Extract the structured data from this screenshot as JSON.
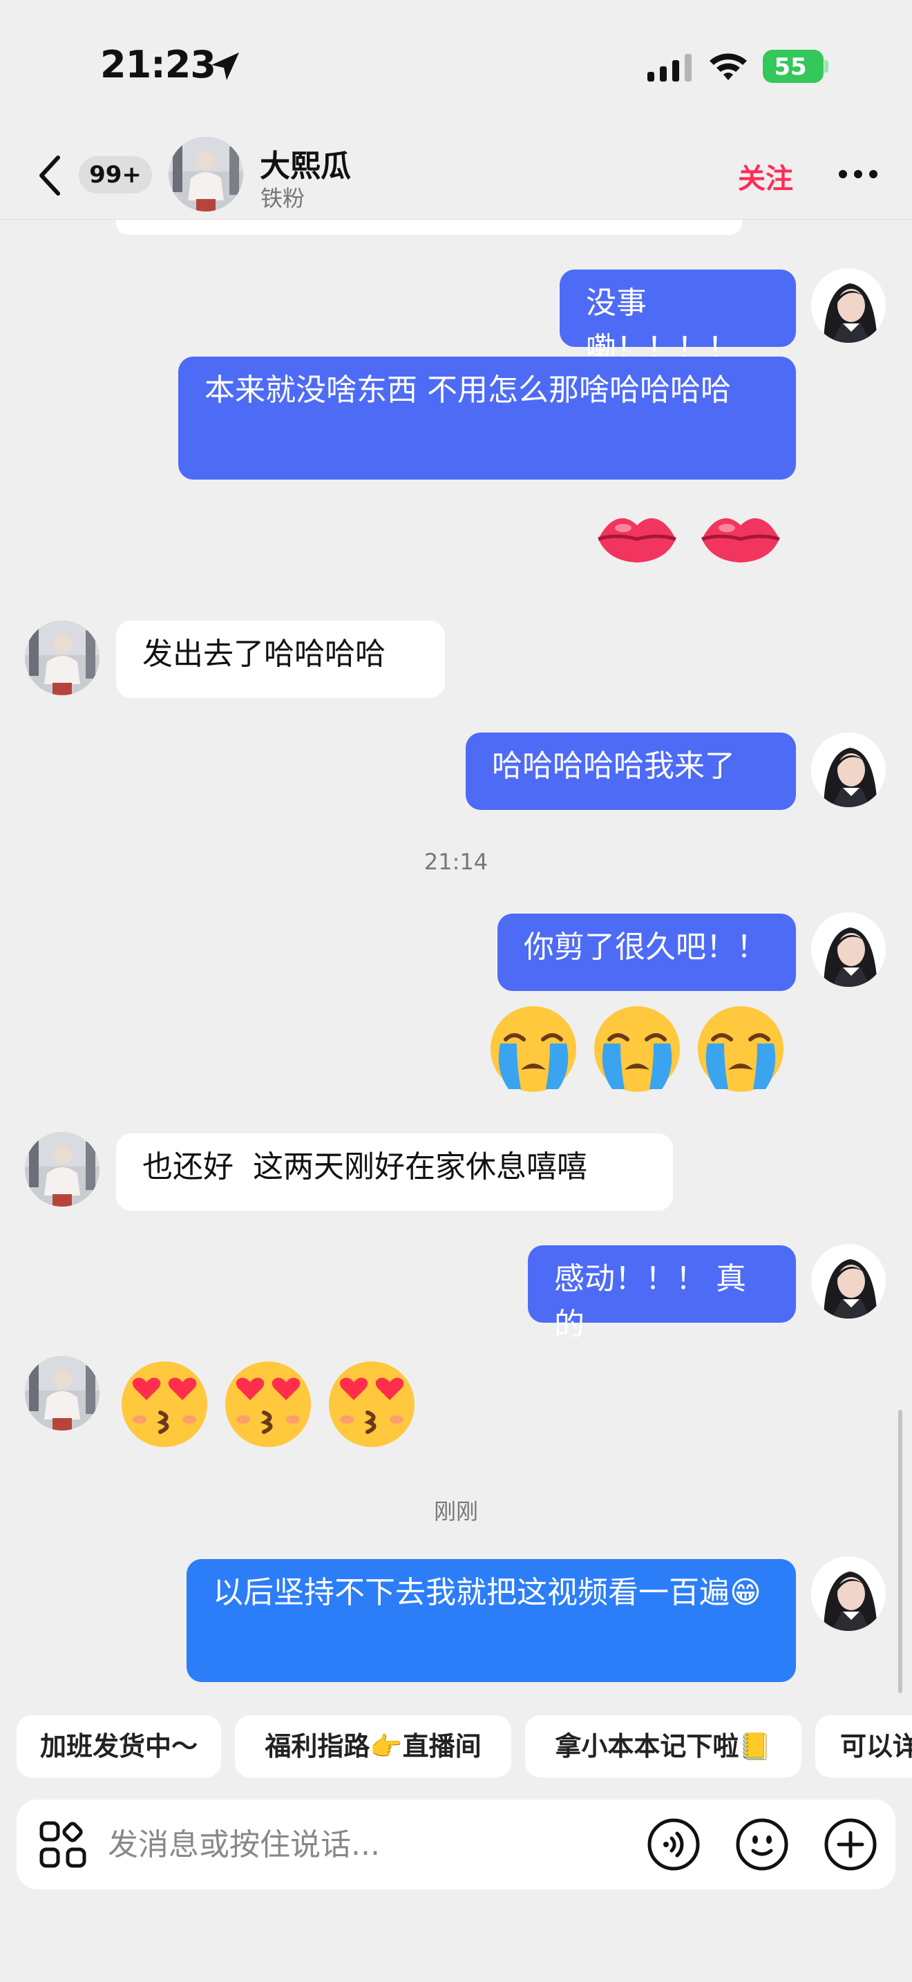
{
  "status_bar": {
    "time": "21:23",
    "battery": "55"
  },
  "header": {
    "unread_count": "99+",
    "contact_name": "大熙瓜",
    "contact_subtitle": "铁粉",
    "follow_label": "关注"
  },
  "messages": [
    {
      "side": "out",
      "text": "没事嘞！！！！"
    },
    {
      "side": "out",
      "text": "本来就没啥东西 不用怎么那啥哈哈哈哈"
    },
    {
      "side": "out",
      "emoji": "kiss-lips",
      "count": 2
    },
    {
      "side": "in",
      "text": "发出去了哈哈哈哈"
    },
    {
      "side": "out",
      "text": "哈哈哈哈哈我来了"
    },
    {
      "type": "time",
      "text": "21:14"
    },
    {
      "side": "out",
      "text": "你剪了很久吧！！"
    },
    {
      "side": "out",
      "emoji": "loudly-crying",
      "count": 3
    },
    {
      "side": "in",
      "text": "也还好  这两天刚好在家休息嘻嘻"
    },
    {
      "side": "out",
      "text": "感动！！！ 真的"
    },
    {
      "side": "in",
      "emoji": "heart-eyes-kiss",
      "count": 3
    },
    {
      "type": "time",
      "text": "刚刚"
    },
    {
      "side": "out",
      "text": "以后坚持不下去我就把这视频看一百遍😁"
    }
  ],
  "quick_replies": [
    "加班发货中～",
    "福利指路👉直播间",
    "拿小本本记下啦📒",
    "可以详"
  ],
  "input": {
    "placeholder": "发消息或按住说话..."
  },
  "icons": [
    "location-arrow-icon",
    "signal-icon",
    "wifi-icon",
    "back-icon",
    "more-icon",
    "apps-icon",
    "voice-icon",
    "emoji-icon",
    "plus-icon"
  ]
}
